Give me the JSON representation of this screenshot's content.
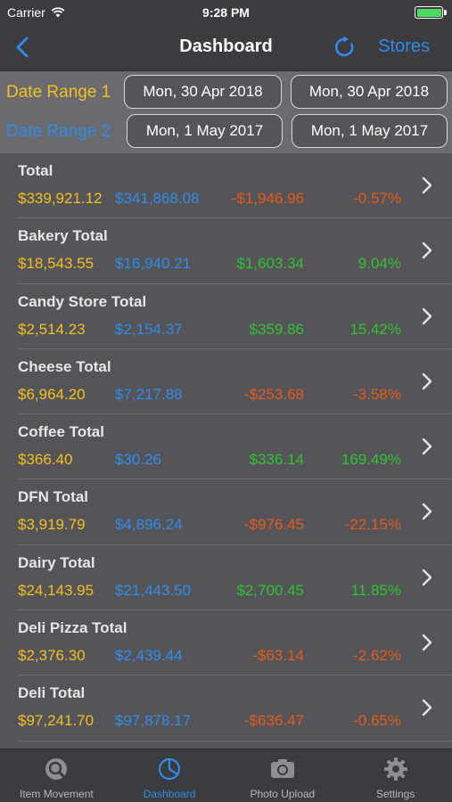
{
  "status_bar": {
    "carrier": "Carrier",
    "time": "9:28 PM"
  },
  "nav": {
    "title": "Dashboard",
    "stores_label": "Stores"
  },
  "date_ranges": {
    "range1_label": "Date Range 1",
    "range2_label": "Date Range 2",
    "range1_start": "Mon, 30 Apr 2018",
    "range1_end": "Mon, 30 Apr 2018",
    "range2_start": "Mon, 1 May 2017",
    "range2_end": "Mon, 1 May 2017"
  },
  "rows": [
    {
      "title": "Total",
      "value1": "$339,921.12",
      "value2": "$341,868.08",
      "diff": "-$1,946.96",
      "pct": "-0.57%",
      "trend": "neg"
    },
    {
      "title": "Bakery Total",
      "value1": "$18,543.55",
      "value2": "$16,940.21",
      "diff": "$1,603.34",
      "pct": "9.04%",
      "trend": "pos"
    },
    {
      "title": "Candy Store Total",
      "value1": "$2,514.23",
      "value2": "$2,154.37",
      "diff": "$359.86",
      "pct": "15.42%",
      "trend": "pos"
    },
    {
      "title": "Cheese Total",
      "value1": "$6,964.20",
      "value2": "$7,217.88",
      "diff": "-$253.68",
      "pct": "-3.58%",
      "trend": "neg"
    },
    {
      "title": "Coffee Total",
      "value1": "$366.40",
      "value2": "$30.26",
      "diff": "$336.14",
      "pct": "169.49%",
      "trend": "pos"
    },
    {
      "title": "DFN Total",
      "value1": "$3,919.79",
      "value2": "$4,896.24",
      "diff": "-$976.45",
      "pct": "-22.15%",
      "trend": "neg"
    },
    {
      "title": "Dairy Total",
      "value1": "$24,143.95",
      "value2": "$21,443.50",
      "diff": "$2,700.45",
      "pct": "11.85%",
      "trend": "pos"
    },
    {
      "title": "Deli Pizza Total",
      "value1": "$2,376.30",
      "value2": "$2,439.44",
      "diff": "-$63.14",
      "pct": "-2.62%",
      "trend": "neg"
    },
    {
      "title": "Deli Total",
      "value1": "$97,241.70",
      "value2": "$97,878.17",
      "diff": "-$636.47",
      "pct": "-0.65%",
      "trend": "neg"
    }
  ],
  "tabs": [
    {
      "label": "Item Movement",
      "icon": "search-icon"
    },
    {
      "label": "Dashboard",
      "icon": "pie-chart-icon"
    },
    {
      "label": "Photo Upload",
      "icon": "camera-icon"
    },
    {
      "label": "Settings",
      "icon": "gear-icon"
    }
  ],
  "active_tab": "Dashboard",
  "colors": {
    "accent": "#2f8ce8",
    "range1": "#f0c020",
    "positive": "#2fc22f",
    "negative": "#e25a1c"
  }
}
